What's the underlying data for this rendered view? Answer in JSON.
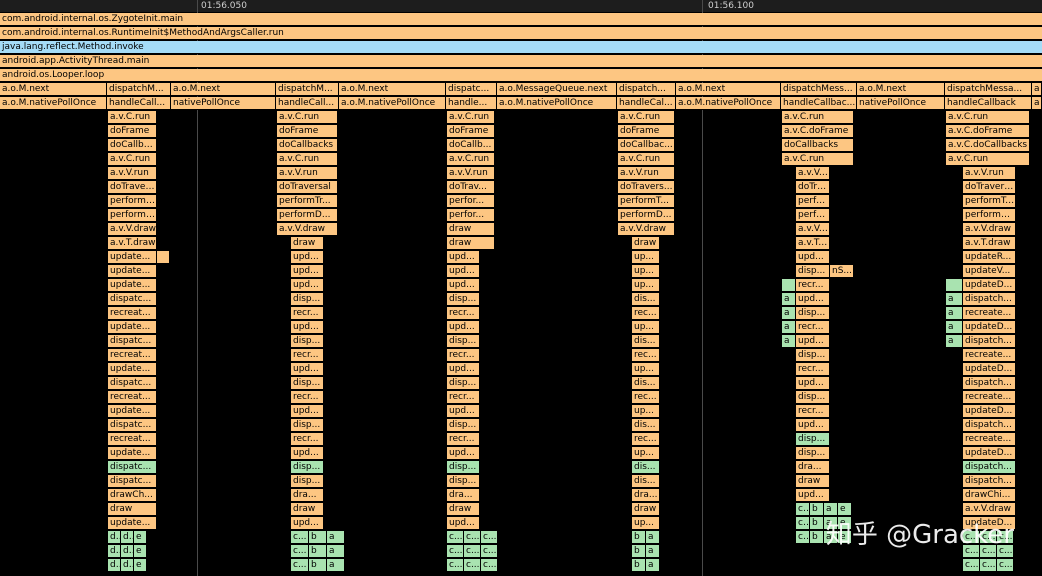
{
  "timeline": {
    "ticks": [
      "01:56.050",
      "01:56.100"
    ]
  },
  "colors": {
    "orange": "#fdc682",
    "blue": "#a5dcf7",
    "green": "#a9e3b0"
  },
  "stack_top": [
    "com.android.internal.os.ZygoteInit.main",
    "com.android.internal.os.RuntimeInit$MethodAndArgsCaller.run",
    "java.lang.reflect.Method.invoke",
    "android.app.ActivityThread.main",
    "android.os.Looper.loop"
  ],
  "groups": [
    {
      "name": "a.o.M.next",
      "child": "a.o.M.nativePollOnce"
    },
    {
      "name": "dispatchM...",
      "child": "handleCall...",
      "deep": [
        "a.v.C.run",
        "doFrame",
        "doCallbacks",
        "a.v.C.run",
        "a.v.V.run",
        "doTraversal",
        "performTr...",
        "performDr...",
        "a.v.V.draw",
        "a.v.T.draw",
        "update...",
        "update...",
        "update...",
        "dispatc...",
        "recreat...",
        "update...",
        "dispatc...",
        "recreat...",
        "update...",
        "dispatc...",
        "recreat...",
        "update...",
        "dispatc...",
        "recreat...",
        "update...",
        "dispatc...",
        "dispatc...",
        "drawCh...",
        "draw",
        "update..."
      ],
      "leaves": [
        "d...",
        "d...",
        "e"
      ]
    },
    {
      "name": "a.o.M.next",
      "child": "nativePollOnce"
    },
    {
      "name": "dispatchM...",
      "child": "handleCall...",
      "deep": [
        "a.v.C.run",
        "doFrame",
        "doCallbacks",
        "a.v.C.run",
        "a.v.V.run",
        "doTraversal",
        "performTr...",
        "performD...",
        "a.v.V.draw",
        "draw",
        "upd...",
        "upd...",
        "upd...",
        "disp...",
        "recr...",
        "upd...",
        "disp...",
        "recr...",
        "upd...",
        "disp...",
        "recr...",
        "upd...",
        "disp...",
        "recr...",
        "upd...",
        "disp...",
        "disp...",
        "dra...",
        "draw",
        "upd..."
      ],
      "leaves": [
        "c...",
        "b",
        "a"
      ]
    },
    {
      "name": "a.o.M.next",
      "child": "a.o.M.nativePollOnce"
    },
    {
      "name": "dispatc...",
      "child": "handle...",
      "deep": [
        "a.v.C.run",
        "doFrame",
        "doCallb...",
        "a.v.C.run",
        "a.v.V.run",
        "doTrav...",
        "perfor...",
        "perfor...",
        "draw",
        "draw",
        "upd...",
        "upd...",
        "upd...",
        "disp...",
        "recr...",
        "upd...",
        "disp...",
        "recr...",
        "upd...",
        "disp...",
        "recr...",
        "upd...",
        "disp...",
        "recr...",
        "upd...",
        "disp...",
        "disp...",
        "dra...",
        "draw",
        "upd..."
      ],
      "leaves": [
        "c...",
        "c...",
        "c..."
      ]
    },
    {
      "name": "a.o.MessageQueue.next",
      "child": "a.o.M.nativePollOnce"
    },
    {
      "name": "dispatch...",
      "child": "handleCal...",
      "deep": [
        "a.v.C.run",
        "doFrame",
        "doCallbac...",
        "a.v.C.run",
        "a.v.V.run",
        "doTravers...",
        "performT...",
        "performD...",
        "a.v.V.draw",
        "draw",
        "up...",
        "up...",
        "up...",
        "dis...",
        "rec...",
        "up...",
        "dis...",
        "rec...",
        "up...",
        "dis...",
        "rec...",
        "up...",
        "dis...",
        "rec...",
        "up...",
        "dis...",
        "dis...",
        "dra...",
        "draw",
        "up..."
      ],
      "leaves": [
        "b",
        "a"
      ]
    },
    {
      "name": "a.o.M.next",
      "child": "a.o.M.nativePollOnce"
    },
    {
      "name": "dispatchMess...",
      "child": "handleCallbac...",
      "deep": [
        "a.v.C.run",
        "a.v.C.doFrame",
        "doCallbacks",
        "a.v.C.run",
        "a.v.V.run",
        "doTravers...",
        "performT...",
        "performD...",
        "a.v.V.draw",
        "a.v.T.draw",
        "upd...",
        "disp...",
        "recr...",
        "upd...",
        "disp...",
        "recr...",
        "upd...",
        "disp...",
        "recr...",
        "upd...",
        "disp...",
        "recr...",
        "upd...",
        "disp...",
        "disp...",
        "dra...",
        "draw",
        "upd..."
      ],
      "extra": "nS...",
      "side": [
        "a",
        "a",
        "a",
        "a"
      ],
      "leaves": [
        "c...",
        "b",
        "a",
        "e"
      ]
    },
    {
      "name": "a.o.M.next",
      "child": "nativePollOnce"
    },
    {
      "name": "dispatchMessa...",
      "child": "handleCallback",
      "deep": [
        "a.v.C.run",
        "a.v.C.doFrame",
        "a.v.C.doCallbacks",
        "a.v.C.run",
        "a.v.V.run",
        "doTraversal",
        "performTra...",
        "performDra...",
        "a.v.V.draw",
        "a.v.T.draw",
        "updateR...",
        "updateV...",
        "updateD...",
        "dispatch...",
        "recreate...",
        "updateD...",
        "dispatch...",
        "recreate...",
        "updateD...",
        "dispatch...",
        "recreate...",
        "updateD...",
        "dispatch...",
        "recreate...",
        "updateD...",
        "dispatch...",
        "dispatch...",
        "drawChi...",
        "a.v.V.draw",
        "updateD..."
      ],
      "side": [
        "a",
        "a",
        "a",
        "a"
      ],
      "leaves": [
        "c...",
        "c...",
        "c..."
      ]
    },
    {
      "name": "a",
      "child": "a"
    }
  ],
  "watermark": "知乎 @Gracker"
}
